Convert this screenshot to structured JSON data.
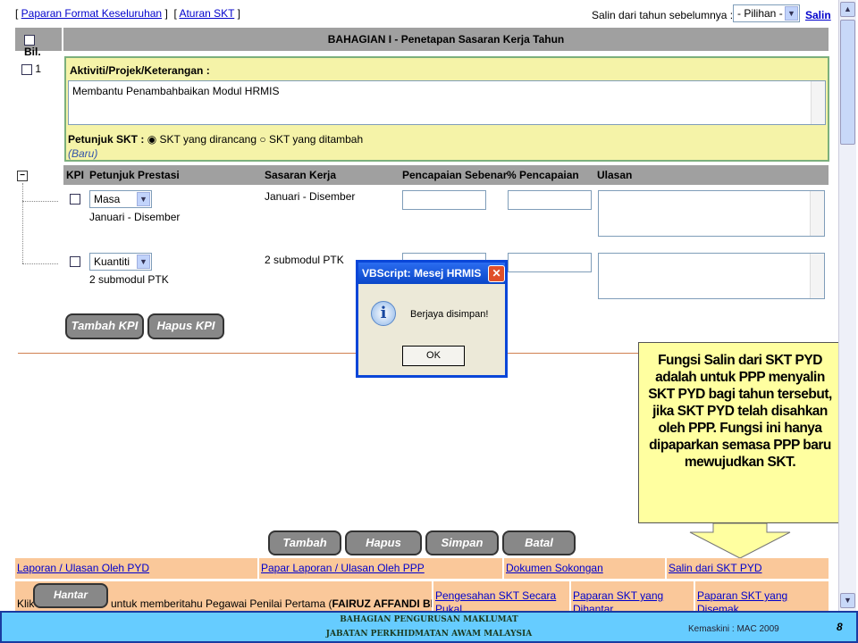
{
  "top_links": {
    "format": "Paparan Format Keseluruhan",
    "aturan": "Aturan SKT",
    "copy_label": "Salin dari tahun sebelumnya :",
    "copy_select": "- Pilihan -",
    "copy_button": "Salin"
  },
  "table_header": {
    "bil": "Bil.",
    "title": "BAHAGIAN I - Penetapan Sasaran Kerja Tahun"
  },
  "item": {
    "number": "1",
    "activity_label": "Aktiviti/Projek/Keterangan :",
    "activity_value": "Membantu Penambahbaikan Modul HRMIS",
    "petunjuk_label": "Petunjuk SKT :",
    "radio1": "SKT yang dirancang",
    "radio2": "SKT yang ditambah",
    "status": "(Baru)"
  },
  "kpi_header": {
    "kpi": "KPI",
    "petunjuk": "Petunjuk Prestasi",
    "sasaran": "Sasaran Kerja",
    "pencapaian": "Pencapaian Sebenar",
    "peratus": "% Pencapaian",
    "ulasan": "Ulasan"
  },
  "kpi_rows": [
    {
      "select": "Masa",
      "desc": "Januari - Disember",
      "sasaran": "Januari - Disember"
    },
    {
      "select": "Kuantiti",
      "desc": "2 submodul PTK",
      "sasaran": "2 submodul PTK"
    }
  ],
  "kpi_buttons": {
    "add": "Tambah KPI",
    "remove": "Hapus KPI"
  },
  "dialog": {
    "title": "VBScript: Mesej HRMIS",
    "message": "Berjaya disimpan!",
    "ok": "OK"
  },
  "callout": {
    "text": "Fungsi Salin dari SKT PYD adalah untuk PPP menyalin SKT PYD bagi tahun tersebut, jika SKT PYD telah disahkan oleh PPP. Fungsi ini hanya dipaparkan semasa PPP baru mewujudkan SKT."
  },
  "actions": {
    "tambah": "Tambah",
    "hapus": "Hapus",
    "simpan": "Simpan",
    "batal": "Batal"
  },
  "links": {
    "laporan_pyd": "Laporan / Ulasan Oleh PYD",
    "laporan_ppp": "Papar Laporan / Ulasan Oleh PPP",
    "dokumen": "Dokumen Sokongan",
    "salin_pyd": "Salin dari SKT PYD"
  },
  "submit": {
    "klik": "Klik",
    "hantar": "Hantar",
    "text": "untuk memberitahu Pegawai Penilai Pertama (",
    "name": "FAIRUZ AFFANDI BIN",
    "link1": "Pengesahan SKT Secara Pukal",
    "link2": "Paparan SKT yang Dihantar",
    "link3": "Paparan SKT yang Disemak"
  },
  "footer": {
    "line1": "BAHAGIAN PENGURUSAN MAKLUMAT",
    "line2": "JABATAN PERKHIDMATAN AWAM MALAYSIA",
    "updated": "Kemaskini : MAC 2009",
    "page": "8"
  }
}
